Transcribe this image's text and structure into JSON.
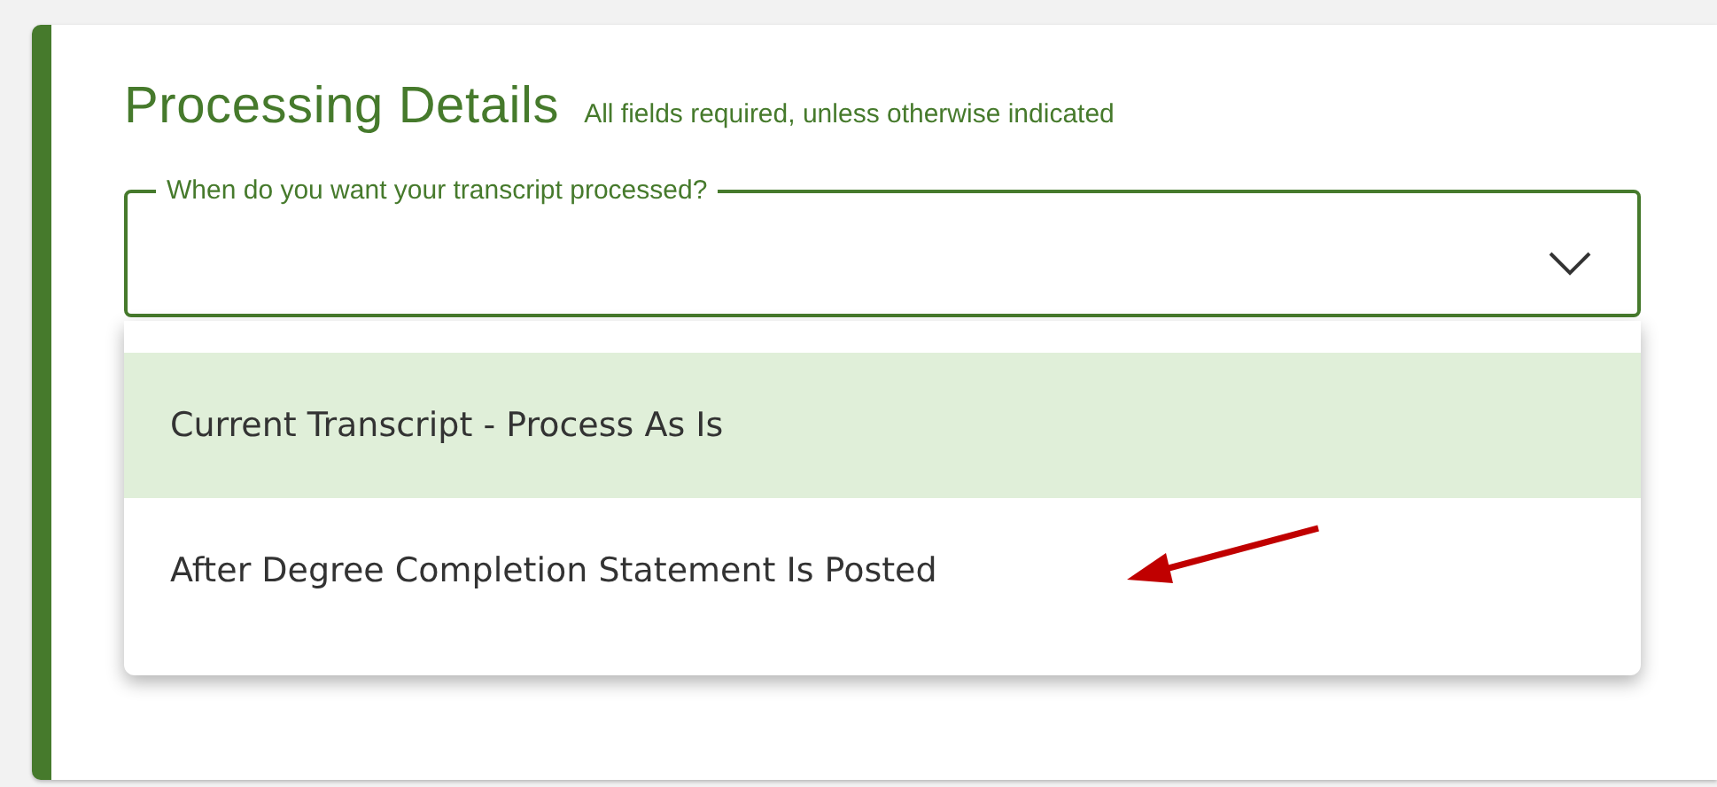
{
  "section": {
    "title": "Processing Details",
    "note": "All fields required, unless otherwise indicated"
  },
  "field": {
    "label": "When do you want your transcript processed?",
    "expanded": true
  },
  "options": [
    {
      "label": "Current Transcript - Process As Is",
      "selected": true
    },
    {
      "label": "After Degree Completion Statement Is Posted",
      "selected": false
    }
  ],
  "annotation": {
    "kind": "arrow",
    "color": "#c00000"
  }
}
